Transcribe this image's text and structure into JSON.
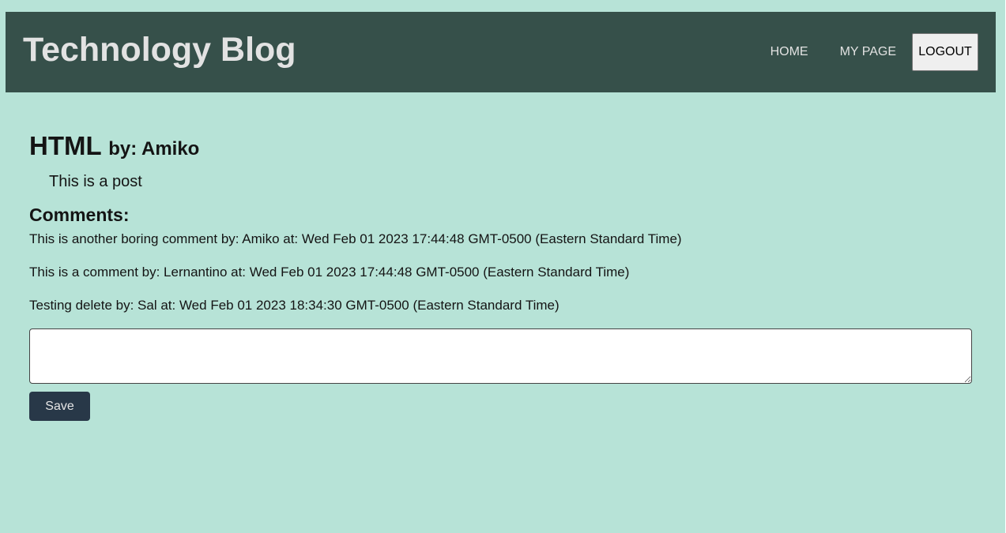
{
  "header": {
    "site_title": "Technology Blog",
    "nav": {
      "home": "HOME",
      "my_page": "MY PAGE",
      "logout": "LOGOUT"
    }
  },
  "post": {
    "title": "HTML",
    "author_line": "by: Amiko",
    "body": "This is a post"
  },
  "comments": {
    "heading": "Comments:",
    "items": [
      "This is another boring comment by: Amiko at: Wed Feb 01 2023 17:44:48 GMT-0500 (Eastern Standard Time)",
      "This is a comment by: Lernantino at: Wed Feb 01 2023 17:44:48 GMT-0500 (Eastern Standard Time)",
      "Testing delete by: Sal at: Wed Feb 01 2023 18:34:30 GMT-0500 (Eastern Standard Time)"
    ],
    "input_value": "",
    "save_label": "Save"
  },
  "colors": {
    "page_background": "#b7e3d7",
    "header_background": "#36504a",
    "header_text": "#e2e2e2",
    "save_button_background": "#283848"
  }
}
